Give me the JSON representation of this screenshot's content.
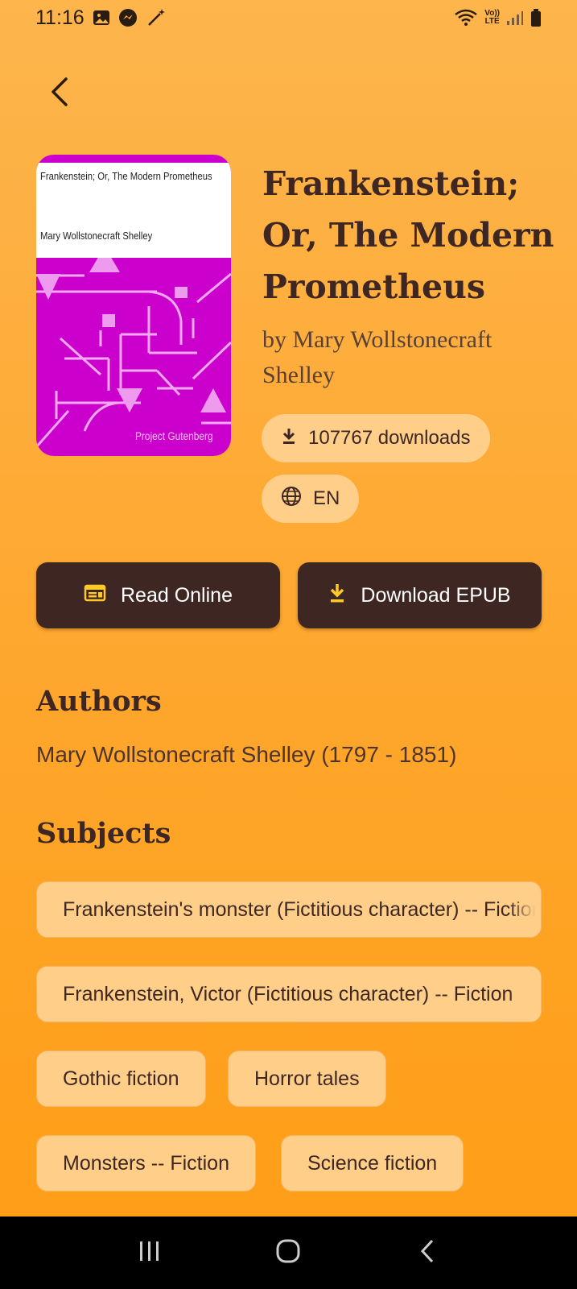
{
  "status_bar": {
    "time": "11:16",
    "icons_left": [
      "gallery-icon",
      "messenger-icon",
      "magic-wand-icon"
    ],
    "icons_right": [
      "wifi-icon",
      "volte-icon",
      "signal-icon",
      "battery-icon"
    ],
    "volte_label_top": "Vo))",
    "volte_label_bottom": "LTE"
  },
  "book": {
    "title": "Frankenstein; Or, The Modern Prometheus",
    "author_line": "by Mary Wollstonecraft Shelley",
    "cover": {
      "title": "Frankenstein; Or, The Modern Prometheus",
      "author": "Mary Wollstonecraft Shelley",
      "publisher": "Project Gutenberg",
      "background_color": "#cc00cc"
    },
    "downloads": "107767 downloads",
    "language": "EN"
  },
  "actions": {
    "read_online": "Read Online",
    "download_epub": "Download EPUB"
  },
  "authors": {
    "heading": "Authors",
    "list": [
      "Mary Wollstonecraft Shelley (1797 - 1851)"
    ]
  },
  "subjects": {
    "heading": "Subjects",
    "items": [
      "Frankenstein's monster (Fictitious character) -- Fiction",
      "Frankenstein, Victor (Fictitious character) -- Fiction",
      "Gothic fiction",
      "Horror tales",
      "Monsters -- Fiction",
      "Science fiction"
    ]
  },
  "colors": {
    "accent_dark": "#3e2723",
    "chip_bg": "#ffcf8a",
    "button_icon": "#ffca28"
  }
}
